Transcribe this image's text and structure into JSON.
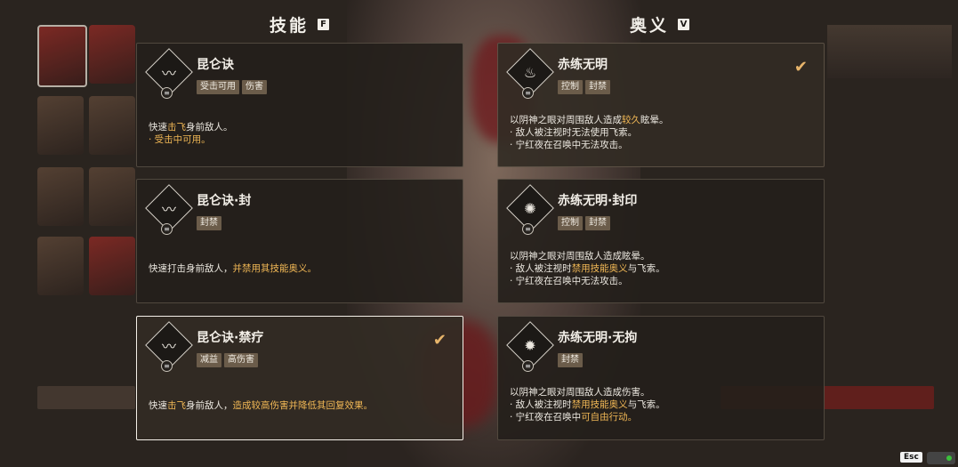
{
  "headers": {
    "skills": {
      "title": "技能",
      "key": "F"
    },
    "ougi": {
      "title": "奥义",
      "key": "V"
    }
  },
  "skills": [
    {
      "name": "昆仑诀",
      "icon": "slash-icon",
      "tags": [
        "受击可用",
        "伤害"
      ],
      "desc_a": "快速",
      "desc_b": "击飞",
      "desc_c": "身前敌人。",
      "line2": "· 受击中可用。"
    },
    {
      "name": "昆仑诀·封",
      "icon": "slash-icon",
      "tags": [
        "封禁"
      ],
      "desc_a": "快速打击身前敌人，",
      "desc_b": "并禁用其技能奥义。"
    },
    {
      "name": "昆仑诀·禁疗",
      "icon": "slash-icon",
      "tags": [
        "减益",
        "高伤害"
      ],
      "desc_a": "快速",
      "desc_b": "击飞",
      "desc_c": "身前敌人，",
      "desc_d": "造成较高伤害并降低其回复效果。"
    }
  ],
  "ougi": [
    {
      "name": "赤练无明",
      "icon": "flame-icon",
      "tags": [
        "控制",
        "封禁"
      ],
      "line1_a": "以阴神之眼对周围敌人造成",
      "line1_b": "较久",
      "line1_c": "眩晕。",
      "line2": "· 敌人被注视时无法使用飞索。",
      "line3": "· 宁红夜在召唤中无法攻击。"
    },
    {
      "name": "赤练无明·封印",
      "icon": "seal-icon",
      "tags": [
        "控制",
        "封禁"
      ],
      "line1": "以阴神之眼对周围敌人造成眩晕。",
      "line2_a": "· 敌人被注视时",
      "line2_b": "禁用技能奥义",
      "line2_c": "与飞索。",
      "line3": "· 宁红夜在召唤中无法攻击。"
    },
    {
      "name": "赤练无明·无拘",
      "icon": "burst-icon",
      "tags": [
        "封禁"
      ],
      "line1": "以阴神之眼对周围敌人造成伤害。",
      "line2_a": "· 敌人被注视时",
      "line2_b": "禁用技能奥义",
      "line2_c": "与飞索。",
      "line3_a": "· 宁红夜在召唤中",
      "line3_b": "可自由行动。"
    }
  ],
  "check": "✔",
  "esc_label": "Esc"
}
